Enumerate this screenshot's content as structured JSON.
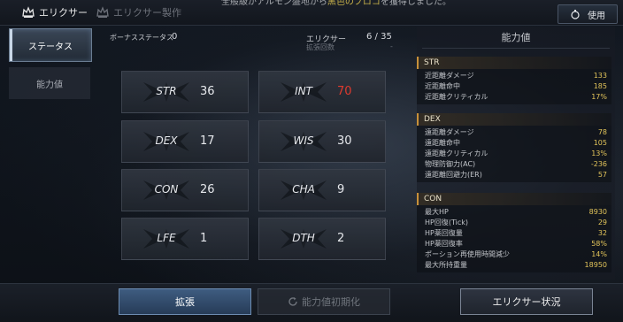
{
  "notice": {
    "pre": "全般級がアルモン盤地から",
    "highlight": "黒色のブロコ",
    "post": "を獲得しました。"
  },
  "tabs": {
    "elixir": "エリクサー",
    "craft": "エリクサー製作"
  },
  "use_button": "使用",
  "sidebar": {
    "status": "ステータス",
    "ability": "能力値"
  },
  "header": {
    "bonus_label": "ボーナスステータス",
    "bonus_value": "0",
    "elixir_label": "エリクサー",
    "elixir_value": "6 / 35",
    "expand_label": "拡張回数",
    "expand_value": "-"
  },
  "stats": [
    {
      "name": "STR",
      "value": "36"
    },
    {
      "name": "INT",
      "value": "70",
      "highlight": true
    },
    {
      "name": "DEX",
      "value": "17"
    },
    {
      "name": "WIS",
      "value": "30"
    },
    {
      "name": "CON",
      "value": "26"
    },
    {
      "name": "CHA",
      "value": "9"
    },
    {
      "name": "LFE",
      "value": "1"
    },
    {
      "name": "DTH",
      "value": "2"
    }
  ],
  "ability_panel": {
    "title": "能力値",
    "groups": [
      {
        "name": "STR",
        "rows": [
          {
            "k": "近距離ダメージ",
            "v": "133"
          },
          {
            "k": "近距離命中",
            "v": "185"
          },
          {
            "k": "近距離クリティカル",
            "v": "17%"
          }
        ]
      },
      {
        "name": "DEX",
        "rows": [
          {
            "k": "遠距離ダメージ",
            "v": "78"
          },
          {
            "k": "遠距離命中",
            "v": "105"
          },
          {
            "k": "遠距離クリティカル",
            "v": "13%"
          },
          {
            "k": "物理防御力(AC)",
            "v": "-236"
          },
          {
            "k": "遠距離回避力(ER)",
            "v": "57"
          }
        ]
      },
      {
        "name": "CON",
        "rows": [
          {
            "k": "最大HP",
            "v": "8930"
          },
          {
            "k": "HP回復(Tick)",
            "v": "29"
          },
          {
            "k": "HP薬回復量",
            "v": "32"
          },
          {
            "k": "HP薬回復率",
            "v": "58%"
          },
          {
            "k": "ポーション再使用時間減少",
            "v": "14%"
          },
          {
            "k": "最大所持重量",
            "v": "18950"
          }
        ]
      }
    ]
  },
  "buttons": {
    "expand": "拡張",
    "reset": "能力値初期化",
    "status": "エリクサー状況"
  },
  "colors": {
    "accent": "#c7903a",
    "value_gold": "#e2c45a",
    "value_red": "#e03a2e"
  }
}
